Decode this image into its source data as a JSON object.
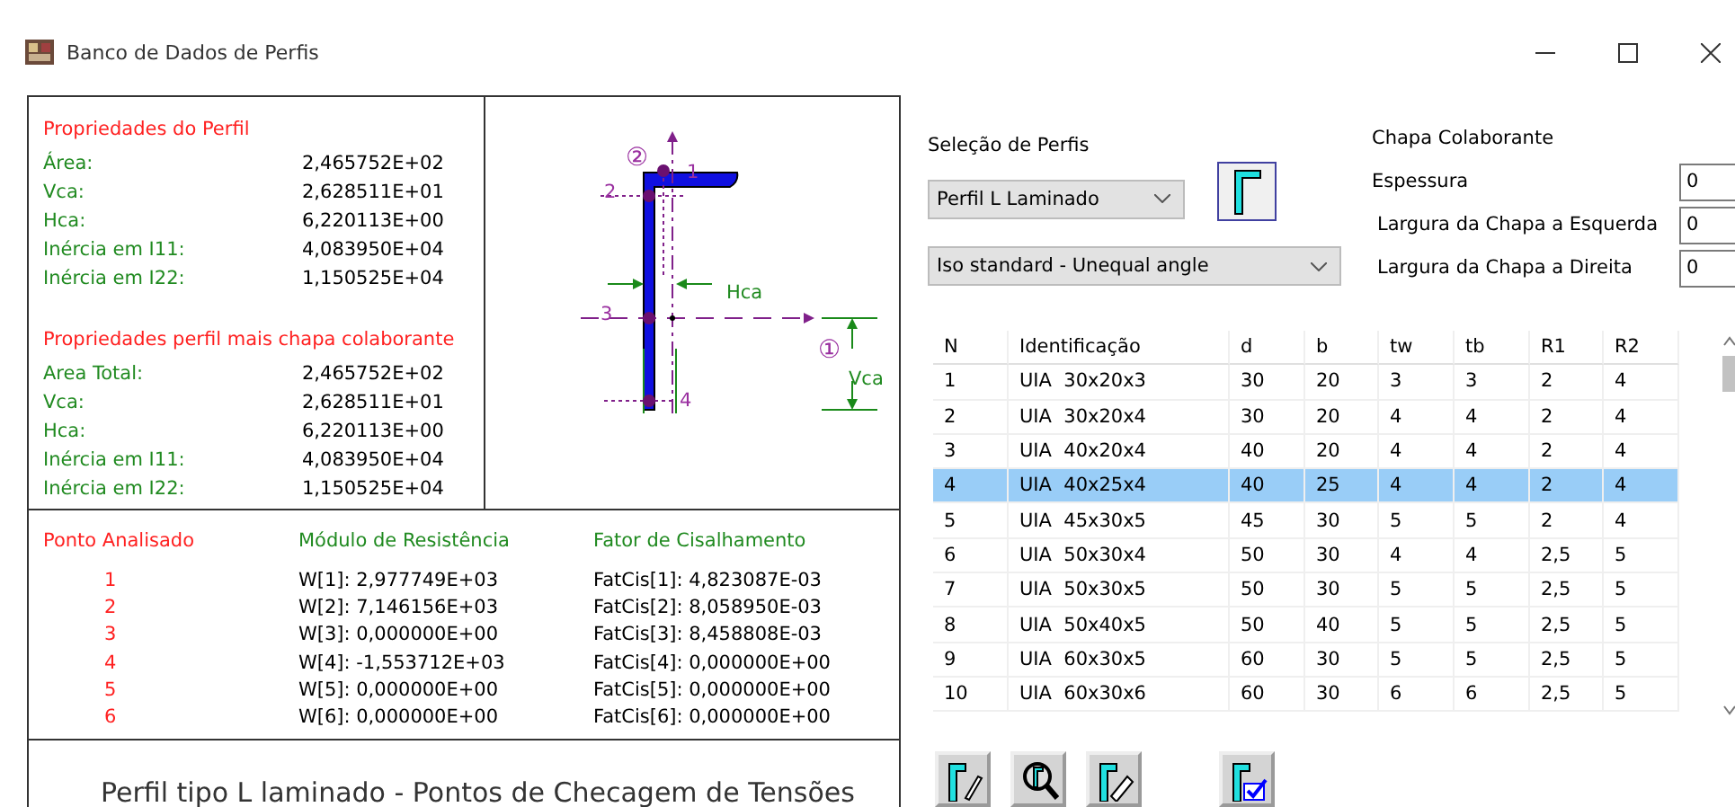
{
  "window": {
    "title": "Banco de Dados de Perfis"
  },
  "profile_properties": {
    "title": "Propriedades do Perfil",
    "rows": [
      {
        "label": "Área:",
        "value": "2,465752E+02"
      },
      {
        "label": "Vca:",
        "value": "2,628511E+01"
      },
      {
        "label": "Hca:",
        "value": "6,220113E+00"
      },
      {
        "label": "Inércia em I11:",
        "value": "4,083950E+04"
      },
      {
        "label": "Inércia em I22:",
        "value": "1,150525E+04"
      }
    ]
  },
  "combined_properties": {
    "title": "Propriedades perfil mais chapa colaborante",
    "rows": [
      {
        "label": "Area Total:",
        "value": "2,465752E+02"
      },
      {
        "label": "Vca:",
        "value": "2,628511E+01"
      },
      {
        "label": "Hca:",
        "value": "6,220113E+00"
      },
      {
        "label": "Inércia em I11:",
        "value": "4,083950E+04"
      },
      {
        "label": "Inércia em I22:",
        "value": "1,150525E+04"
      }
    ]
  },
  "diagram": {
    "point_labels": [
      "1",
      "2",
      "3",
      "4"
    ],
    "circled_labels": [
      "②",
      "①"
    ],
    "hca": "Hca",
    "vca": "Vca"
  },
  "checks": {
    "headers": [
      "Ponto Analisado",
      "Módulo de Resistência",
      "Fator de Cisalhamento"
    ],
    "rows": [
      {
        "point": "1",
        "w": "W[1]: 2,977749E+03",
        "fatcis": "FatCis[1]: 4,823087E-03"
      },
      {
        "point": "2",
        "w": "W[2]: 7,146156E+03",
        "fatcis": "FatCis[2]: 8,058950E-03"
      },
      {
        "point": "3",
        "w": "W[3]: 0,000000E+00",
        "fatcis": "FatCis[3]: 8,458808E-03"
      },
      {
        "point": "4",
        "w": "W[4]: -1,553712E+03",
        "fatcis": "FatCis[4]: 0,000000E+00"
      },
      {
        "point": "5",
        "w": "W[5]: 0,000000E+00",
        "fatcis": "FatCis[5]: 0,000000E+00"
      },
      {
        "point": "6",
        "w": "W[6]: 0,000000E+00",
        "fatcis": "FatCis[6]: 0,000000E+00"
      }
    ]
  },
  "caption": "Perfil tipo L laminado - Pontos de Checagem de Tensões",
  "selection": {
    "title": "Seleção de Perfis",
    "profile_type": "Perfil L Laminado",
    "standard": "Iso standard - Unequal angle"
  },
  "plate": {
    "title": "Chapa Colaborante",
    "fields": [
      {
        "label": "Espessura",
        "value": "0"
      },
      {
        "label": "Largura da Chapa a Esquerda",
        "value": "0"
      },
      {
        "label": "Largura da Chapa a Direita",
        "value": "0"
      }
    ]
  },
  "table": {
    "columns": [
      "N",
      "Identificação",
      "d",
      "b",
      "tw",
      "tb",
      "R1",
      "R2"
    ],
    "rows": [
      {
        "cells": [
          "1",
          "UIA  30x20x3",
          "30",
          "20",
          "3",
          "3",
          "2",
          "4"
        ],
        "selected": false
      },
      {
        "cells": [
          "2",
          "UIA  30x20x4",
          "30",
          "20",
          "4",
          "4",
          "2",
          "4"
        ],
        "selected": false
      },
      {
        "cells": [
          "3",
          "UIA  40x20x4",
          "40",
          "20",
          "4",
          "4",
          "2",
          "4"
        ],
        "selected": false
      },
      {
        "cells": [
          "4",
          "UIA  40x25x4",
          "40",
          "25",
          "4",
          "4",
          "2",
          "4"
        ],
        "selected": true
      },
      {
        "cells": [
          "5",
          "UIA  45x30x5",
          "45",
          "30",
          "5",
          "5",
          "2",
          "4"
        ],
        "selected": false
      },
      {
        "cells": [
          "6",
          "UIA  50x30x4",
          "50",
          "30",
          "4",
          "4",
          "2,5",
          "5"
        ],
        "selected": false
      },
      {
        "cells": [
          "7",
          "UIA  50x30x5",
          "50",
          "30",
          "5",
          "5",
          "2,5",
          "5"
        ],
        "selected": false
      },
      {
        "cells": [
          "8",
          "UIA  50x40x5",
          "50",
          "40",
          "5",
          "5",
          "2,5",
          "5"
        ],
        "selected": false
      },
      {
        "cells": [
          "9",
          "UIA  60x30x5",
          "60",
          "30",
          "5",
          "5",
          "2,5",
          "5"
        ],
        "selected": false
      },
      {
        "cells": [
          "10",
          "UIA  60x30x6",
          "60",
          "30",
          "6",
          "6",
          "2,5",
          "5"
        ],
        "selected": false
      }
    ]
  }
}
